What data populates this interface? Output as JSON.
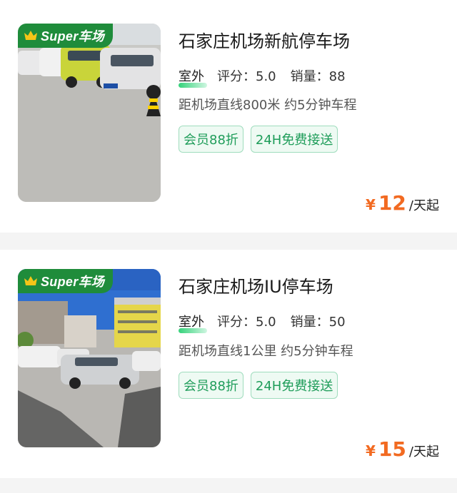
{
  "lots": [
    {
      "badge": "Super车场",
      "title": "石家庄机场新航停车场",
      "type": "室外",
      "rating": "评分：5.0",
      "sales": "销量：88",
      "distance": "距机场直线800米 约5分钟车程",
      "tags": [
        "会员88折",
        "24H免费接送"
      ],
      "currency": "¥",
      "price": "12",
      "unit": "/天起",
      "image": "outdoor-parking-lot-photo"
    },
    {
      "badge": "Super车场",
      "title": "石家庄机场IU停车场",
      "type": "室外",
      "rating": "评分：5.0",
      "sales": "销量：50",
      "distance": "距机场直线1公里 约5分钟车程",
      "tags": [
        "会员88折",
        "24H免费接送"
      ],
      "currency": "¥",
      "price": "15",
      "unit": "/天起",
      "image": "outdoor-parking-lot-photo"
    }
  ],
  "colors": {
    "badge_green": "#1f8c3b",
    "tag_green": "#1f9d5a",
    "price_orange": "#f26a21",
    "crown_gold": "#f5c518"
  }
}
